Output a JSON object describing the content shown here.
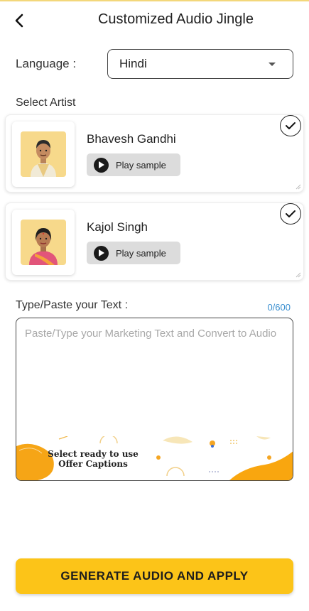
{
  "header": {
    "title": "Customized Audio Jingle",
    "back_icon": "back-arrow-icon"
  },
  "language": {
    "label": "Language :",
    "selected": "Hindi",
    "caret_icon": "caret-down-icon"
  },
  "artists": {
    "label": "Select Artist",
    "items": [
      {
        "name": "Bhavesh Gandhi",
        "play_label": "Play sample",
        "selected": true
      },
      {
        "name": "Kajol Singh",
        "play_label": "Play sample",
        "selected": true
      }
    ]
  },
  "text_input": {
    "label": "Type/Paste your Text :",
    "counter": "0/600",
    "placeholder": "Paste/Type your Marketing Text and Convert to Audio",
    "value": "",
    "caption_banner": "Select ready to use Offer Captions"
  },
  "action": {
    "generate_label": "GENERATE AUDIO AND APPLY"
  },
  "colors": {
    "accent": "#fcc418",
    "counter": "#3a8fd0",
    "placeholder": "#a8a8a8"
  }
}
